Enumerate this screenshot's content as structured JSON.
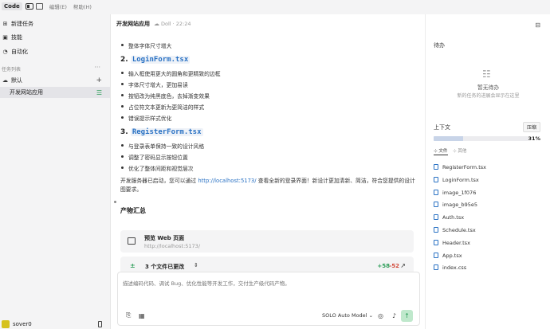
{
  "menubar": {
    "code_tag": "Code",
    "edit_menu": "编辑(E)",
    "help_menu": "帮助(H)"
  },
  "sidebar": {
    "items": [
      {
        "label": "新建任务",
        "icon": "plus-square-icon"
      },
      {
        "label": "技能",
        "icon": "skill-icon"
      },
      {
        "label": "自动化",
        "icon": "automation-icon"
      }
    ],
    "section_label": "任务列表",
    "group_label": "默认",
    "task_label": "开发网站应用",
    "user_name": "sover0"
  },
  "header": {
    "title": "开发网站应用",
    "meta": "Doll · 22:24"
  },
  "content": {
    "bullet_1": "整体字体尺寸增大",
    "heading_2_num": "2.",
    "heading_2_code": "LoginForm.tsx",
    "bullets_2": [
      "输入框使用更大的圆角和更精致的边框",
      "字体尺寸增大，更加易读",
      "按钮改为纯黑底色，去掉渐变效果",
      "占位符文本更新为更简洁的样式",
      "错误提示样式优化"
    ],
    "heading_3_num": "3.",
    "heading_3_code": "RegisterForm.tsx",
    "bullets_3": [
      "与登录表单保持一致的设计风格",
      "调整了密码显示按钮位置",
      "优化了整体间距和视觉层次"
    ],
    "para_pre": "开发服务器已启动，您可以通过 ",
    "para_link": "http://localhost:5173/",
    "para_post": " 查看全新的登录界面！新设计更加清新、简洁，符合您提供的设计图要求。",
    "products_title": "产物汇总",
    "preview_title": "预览 Web 页面",
    "preview_url": "http://localhost:5173/",
    "files_label": "3 个文件已更改",
    "additions": "+58",
    "deletions": "-52"
  },
  "input": {
    "placeholder": "描述编码代码、调试 Bug、优化性能等开发工作，交付生产级代码产物。",
    "model": "SOLO Auto Model"
  },
  "right_panel": {
    "todo_title": "待办",
    "todo_empty": "暂无待办",
    "todo_desc": "新的任务的进展会显示在这里",
    "context_title": "上下文",
    "compress_label": "压缩",
    "context_percent": "31%",
    "context_fraction": 0.31,
    "tab_files": "文件",
    "tab_other": "其他",
    "files": [
      "RegisterForm.tsx",
      "LoginForm.tsx",
      "image_1f076",
      "image_b95e5",
      "Auth.tsx",
      "Schedule.tsx",
      "Header.tsx",
      "App.tsx",
      "index.css"
    ]
  },
  "colors": {
    "accent_green": "#2e9e5a",
    "link_blue": "#2a72c4",
    "delete_red": "#d24a3a"
  }
}
